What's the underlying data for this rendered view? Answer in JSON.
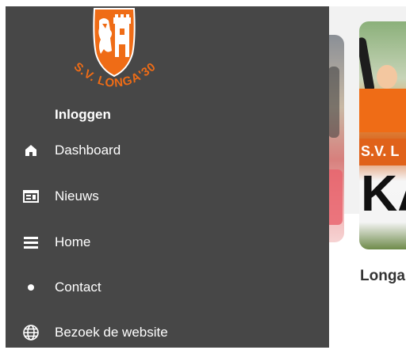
{
  "drawer": {
    "logo": {
      "club_name": "S.V. LONGA'30",
      "colors": {
        "orange": "#ef6c16",
        "white": "#ffffff"
      }
    },
    "login": "Inloggen",
    "items": [
      {
        "label": "Dashboard",
        "icon": "home-icon"
      },
      {
        "label": "Nieuws",
        "icon": "newspaper-icon"
      },
      {
        "label": "Home",
        "icon": "menu-lines-icon"
      },
      {
        "label": "Contact",
        "icon": "dot-icon"
      },
      {
        "label": "Bezoek de website",
        "icon": "globe-icon"
      }
    ],
    "background": "#474747"
  },
  "content": {
    "card_title": "Longa",
    "photo_banner_text": "S.V. L",
    "photo_big_letters": "KA"
  }
}
